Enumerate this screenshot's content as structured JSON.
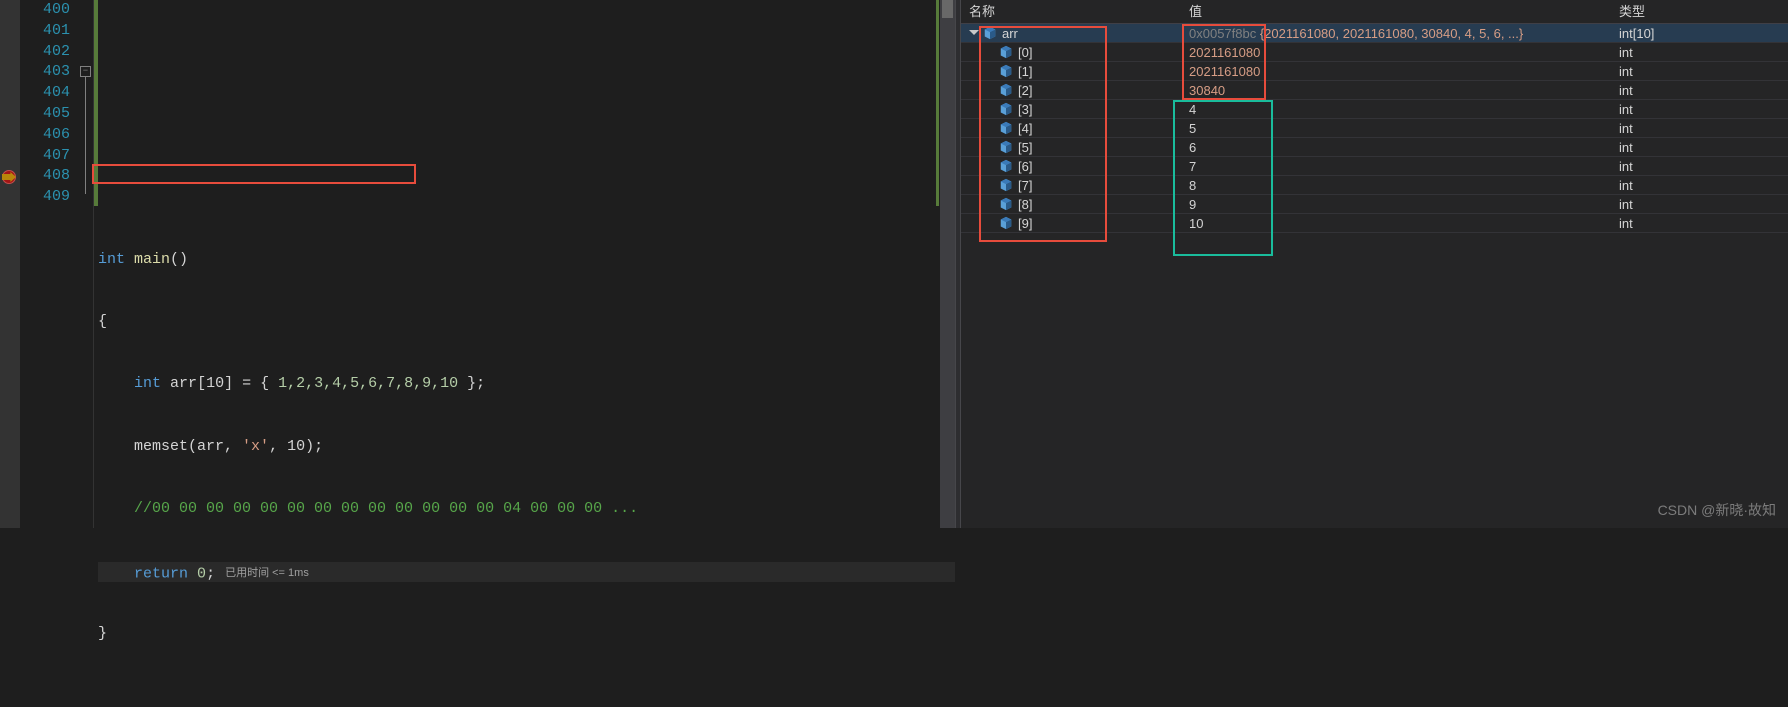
{
  "editor": {
    "lines": [
      400,
      401,
      402,
      403,
      404,
      405,
      406,
      407,
      408,
      409
    ],
    "code": {
      "l402": {
        "kw": "int",
        "fn": "main",
        "rest": "()"
      },
      "l404": {
        "brace": "{"
      },
      "l405": {
        "indent": "    ",
        "kw": "int",
        "var": "arr",
        "dim": "[10] = { ",
        "nums": "1,2,3,4,5,6,7,8,9,10",
        "end": " };"
      },
      "l406": {
        "indent": "    ",
        "fn": "memset",
        "args": "(arr, ",
        "str": "'x'",
        "rest": ", 10);"
      },
      "l407": {
        "indent": "    ",
        "comment": "//00 00 00 00 00 00 00 00 00 00 00 00 00 04 00 00 00 ..."
      },
      "l408": {
        "indent": "    ",
        "kw": "return",
        "sp": " ",
        "num": "0",
        "semi": ";"
      },
      "l409": {
        "brace": "}"
      }
    },
    "time_badge": "已用时间 <= 1ms"
  },
  "watch": {
    "headers": {
      "name": "名称",
      "value": "值",
      "type": "类型"
    },
    "rows": [
      {
        "depth": 0,
        "expand": true,
        "name": "arr",
        "addr": "0x0057f8bc",
        "val": "{2021161080, 2021161080, 30840, 4, 5, 6, ...}",
        "type": "int[10]",
        "changed": true
      },
      {
        "depth": 1,
        "name": "[0]",
        "val": "2021161080",
        "type": "int",
        "changed": true
      },
      {
        "depth": 1,
        "name": "[1]",
        "val": "2021161080",
        "type": "int",
        "changed": true
      },
      {
        "depth": 1,
        "name": "[2]",
        "val": "30840",
        "type": "int",
        "changed": true
      },
      {
        "depth": 1,
        "name": "[3]",
        "val": "4",
        "type": "int"
      },
      {
        "depth": 1,
        "name": "[4]",
        "val": "5",
        "type": "int"
      },
      {
        "depth": 1,
        "name": "[5]",
        "val": "6",
        "type": "int"
      },
      {
        "depth": 1,
        "name": "[6]",
        "val": "7",
        "type": "int"
      },
      {
        "depth": 1,
        "name": "[7]",
        "val": "8",
        "type": "int"
      },
      {
        "depth": 1,
        "name": "[8]",
        "val": "9",
        "type": "int"
      },
      {
        "depth": 1,
        "name": "[9]",
        "val": "10",
        "type": "int"
      }
    ]
  },
  "watermark": "CSDN @新晓·故知"
}
